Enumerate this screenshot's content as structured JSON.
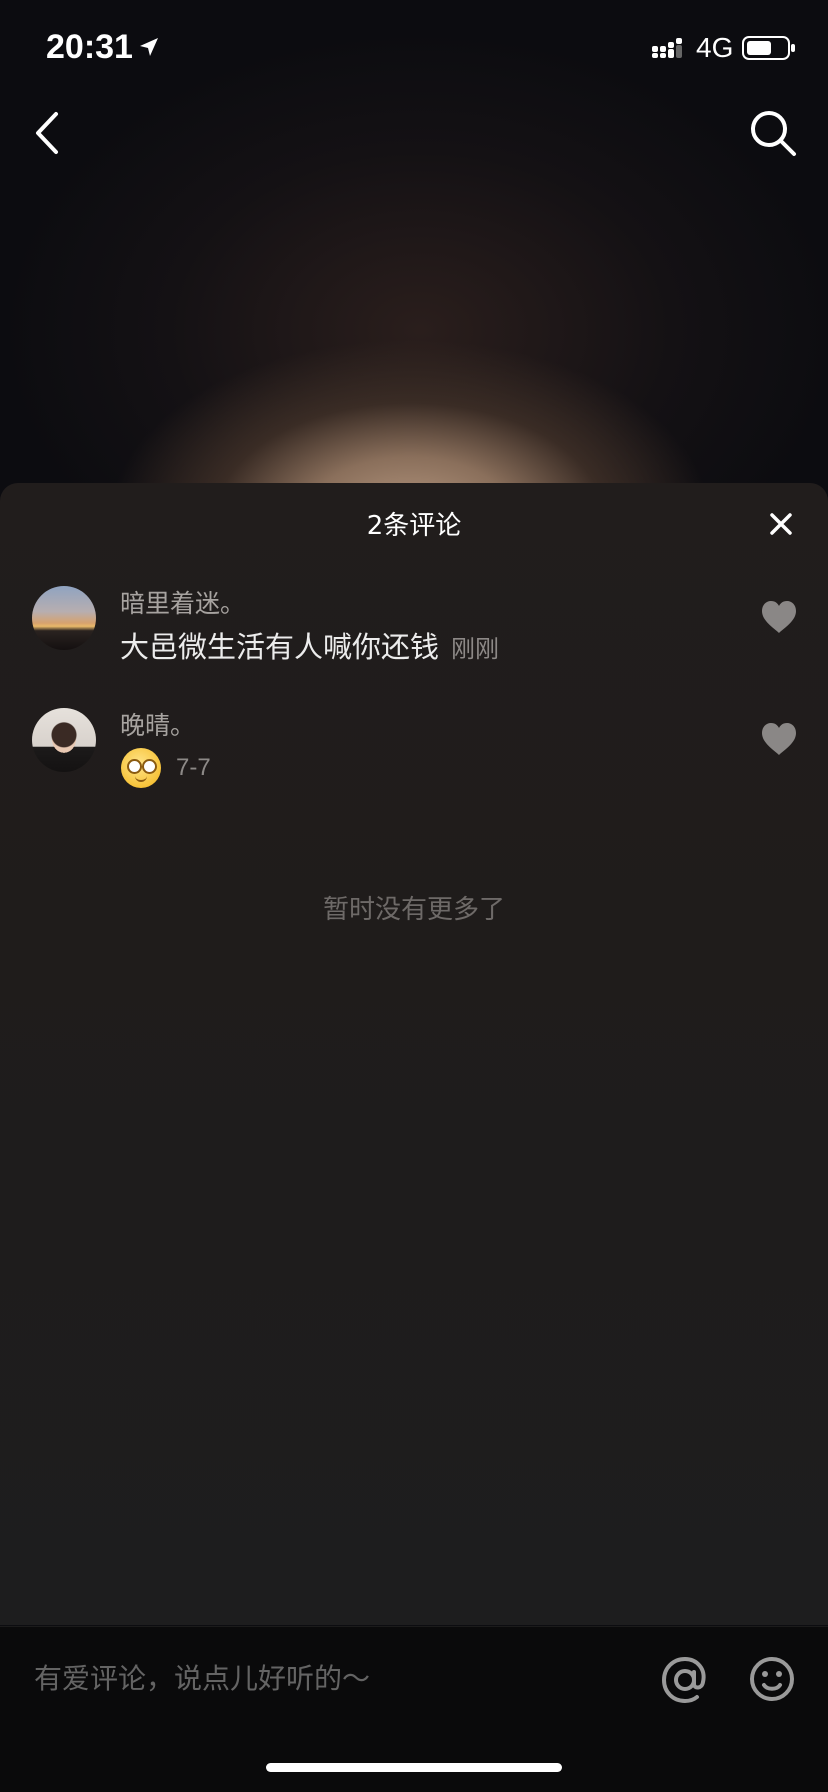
{
  "status_bar": {
    "time": "20:31",
    "network": "4G",
    "icons": [
      "location-arrow-icon",
      "signal-icon",
      "battery-icon"
    ]
  },
  "nav": {
    "icons": [
      "back-icon",
      "search-icon"
    ]
  },
  "comments_panel": {
    "title": "2条评论",
    "close_icon": "close-icon",
    "comments": [
      {
        "username": "暗里着迷。",
        "text": "大邑微生活有人喊你还钱",
        "time": "刚刚",
        "like_icon": "heart-icon"
      },
      {
        "username": "晚晴。",
        "text": "",
        "emoji": "smiling-face-emoji",
        "time": "7-7",
        "like_icon": "heart-icon"
      }
    ],
    "no_more_text": "暂时没有更多了"
  },
  "input_bar": {
    "placeholder": "有爱评论，说点儿好听的～",
    "icons": [
      "at-icon",
      "emoji-icon"
    ]
  },
  "colors": {
    "sheet_bg": "#201d1c",
    "text_primary": "#ececec",
    "text_secondary": "#a7a3a0",
    "text_muted": "#6e6a68",
    "heart": "#8a8786"
  }
}
